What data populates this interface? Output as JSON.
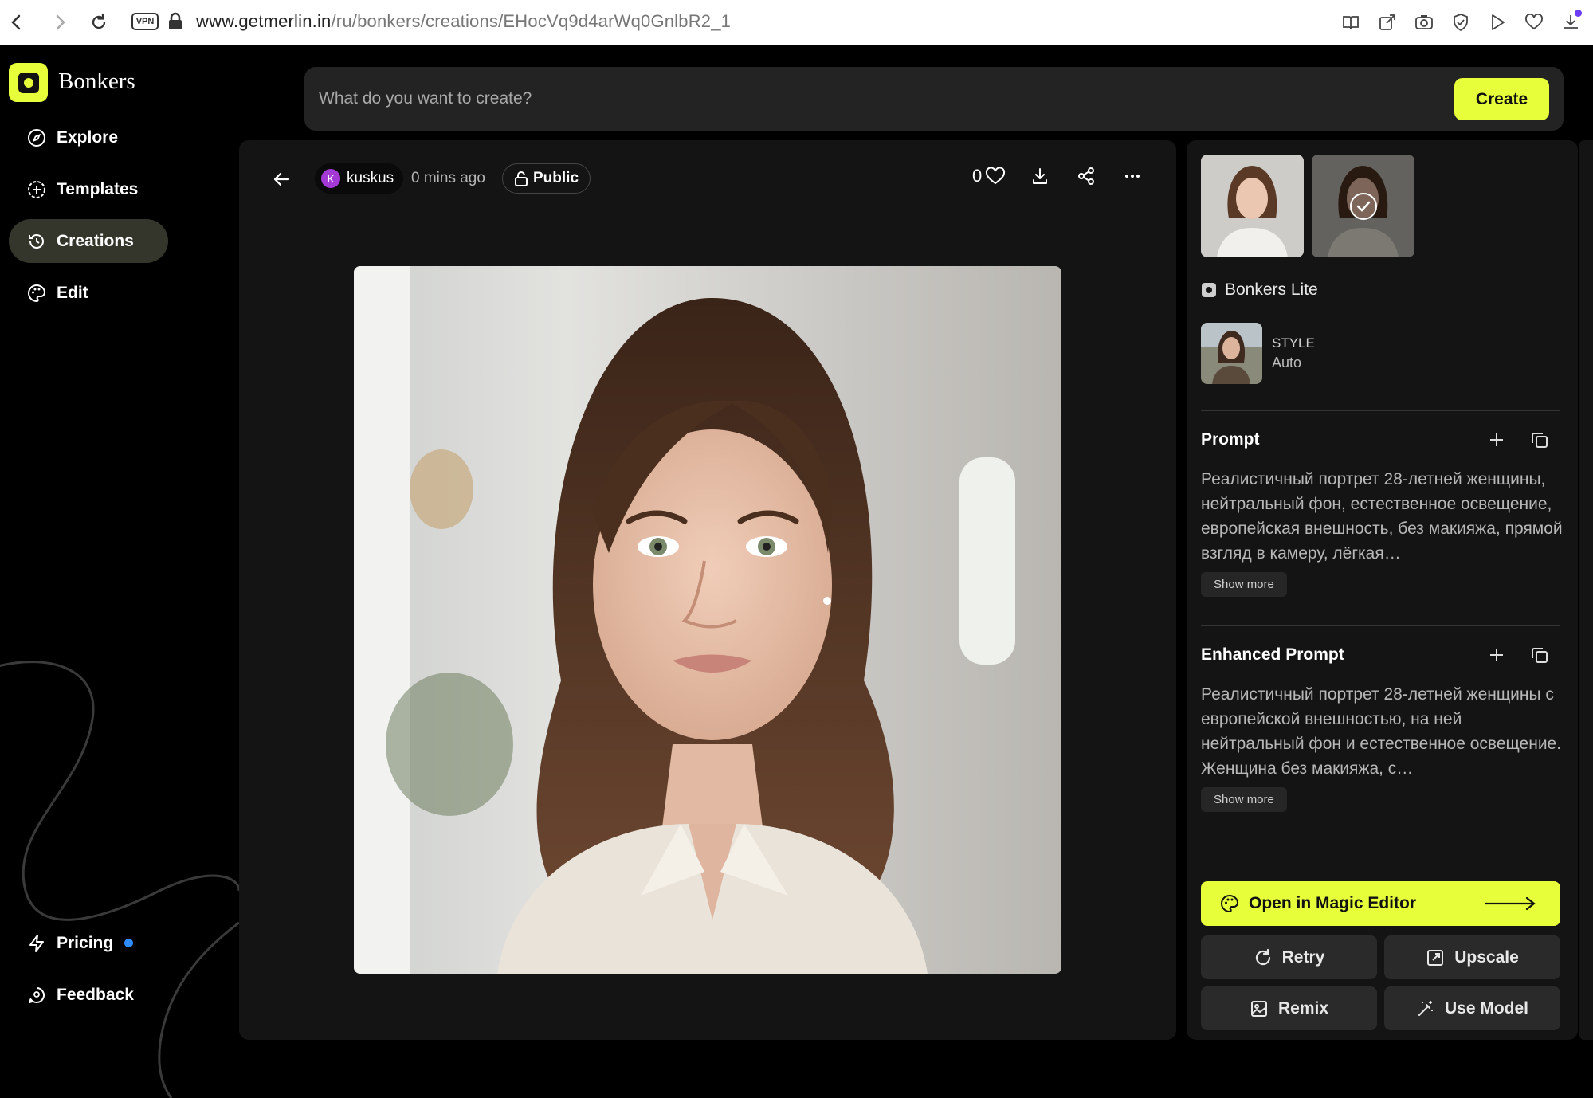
{
  "browser": {
    "vpn_label": "VPN",
    "url_host": "www.getmerlin.in",
    "url_path": "/ru/bonkers/creations/EHocVq9d4arWq0GnlbR2_1"
  },
  "app": {
    "brand": "Bonkers",
    "nav": [
      {
        "label": "Explore",
        "icon": "compass-icon"
      },
      {
        "label": "Templates",
        "icon": "plus-circle-icon"
      },
      {
        "label": "Creations",
        "icon": "history-icon",
        "active": true
      },
      {
        "label": "Edit",
        "icon": "palette-icon"
      }
    ],
    "bottom_nav": [
      {
        "label": "Pricing",
        "icon": "bolt-icon"
      },
      {
        "label": "Feedback",
        "icon": "chat-icon"
      }
    ],
    "accent": "#e6ff3a"
  },
  "search": {
    "placeholder": "What do you want to create?",
    "create_label": "Create"
  },
  "creation": {
    "author_initial": "K",
    "author": "kuskus",
    "time": "0 mins ago",
    "visibility": "Public",
    "likes": "0"
  },
  "details": {
    "model": "Bonkers Lite",
    "style_label": "STYLE",
    "style_value": "Auto",
    "prompt_title": "Prompt",
    "prompt_text": "Реалистичный портрет 28-летней женщины, нейтральный фон, естественное освещение, европейская внешность, без макияжа, прямой взгляд в камеру, лёгкая…",
    "show_more": "Show more",
    "enhanced_title": "Enhanced Prompt",
    "enhanced_text": "Реалистичный портрет 28-летней женщины с европейской внешностью, на ней нейтральный фон и естественное освещение. Женщина без макияжа, с…",
    "enhanced_show_more": "Show more",
    "magic_label": "Open in Magic Editor",
    "actions": [
      {
        "label": "Retry",
        "icon": "refresh-icon"
      },
      {
        "label": "Upscale",
        "icon": "upscale-icon"
      },
      {
        "label": "Remix",
        "icon": "image-icon"
      },
      {
        "label": "Use Model",
        "icon": "wand-icon"
      }
    ]
  }
}
